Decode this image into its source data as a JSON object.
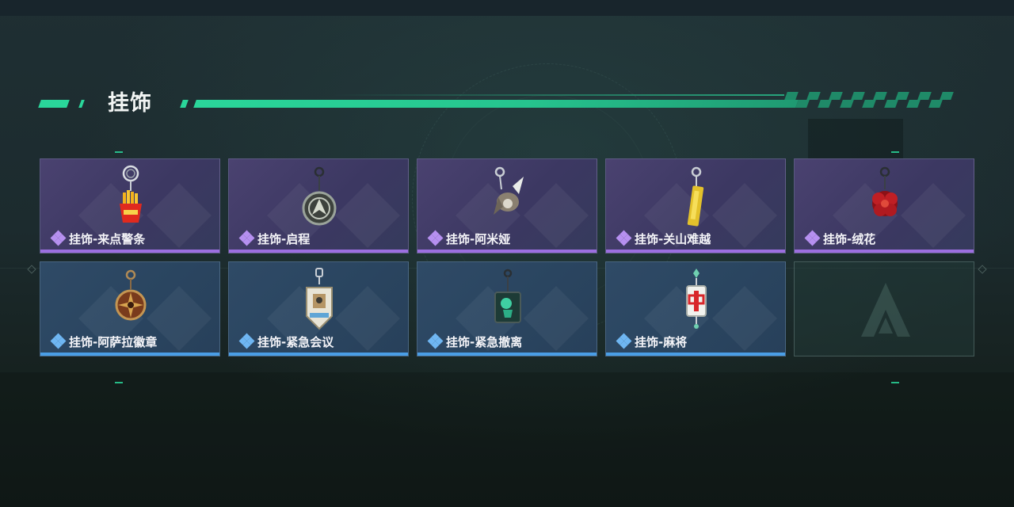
{
  "section": {
    "title": "挂饰"
  },
  "items": [
    {
      "label": "挂饰-来点警条",
      "rarity": "purple",
      "icon": "fries-charm-icon"
    },
    {
      "label": "挂饰-启程",
      "rarity": "purple",
      "icon": "emblem-ring-charm-icon"
    },
    {
      "label": "挂饰-阿米娅",
      "rarity": "purple",
      "icon": "bunny-charm-icon"
    },
    {
      "label": "挂饰-关山难越",
      "rarity": "purple",
      "icon": "gold-bar-charm-icon"
    },
    {
      "label": "挂饰-绒花",
      "rarity": "purple",
      "icon": "red-flower-charm-icon"
    },
    {
      "label": "挂饰-阿萨拉徽章",
      "rarity": "blue",
      "icon": "compass-badge-charm-icon"
    },
    {
      "label": "挂饰-紧急会议",
      "rarity": "blue",
      "icon": "crest-charm-icon"
    },
    {
      "label": "挂饰-紧急撤离",
      "rarity": "blue",
      "icon": "green-tablet-charm-icon"
    },
    {
      "label": "挂饰-麻将",
      "rarity": "blue",
      "icon": "mahjong-tile-charm-icon"
    }
  ],
  "empty_slot": {
    "icon": "game-logo-icon"
  },
  "colors": {
    "accent": "#2ad69a",
    "purple_rarity": "#9c6fe0",
    "blue_rarity": "#4a9ee6",
    "mahjong_red": "#d8262a"
  }
}
